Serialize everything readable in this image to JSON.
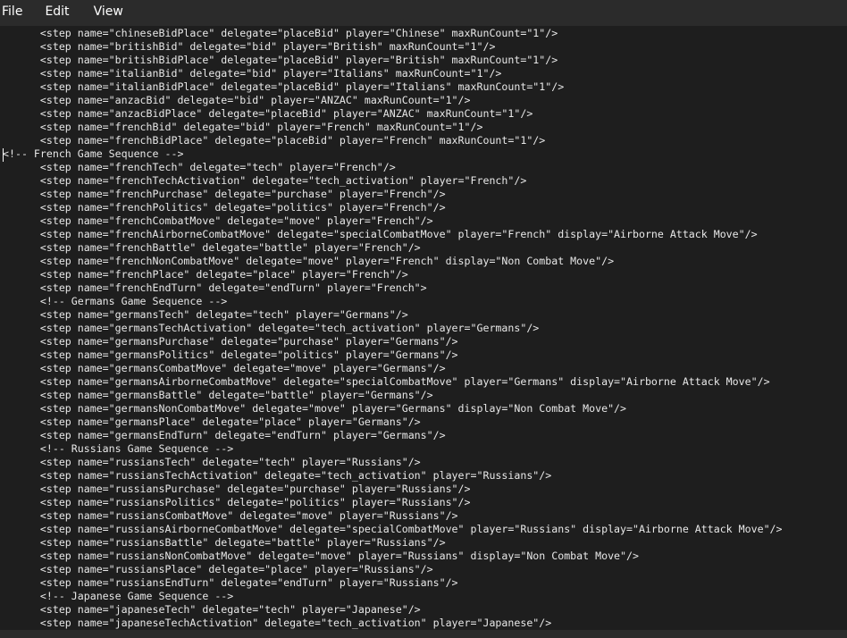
{
  "menu": {
    "file": "File",
    "edit": "Edit",
    "view": "View"
  },
  "editor": {
    "lines": [
      "      <step name=\"chineseBidPlace\" delegate=\"placeBid\" player=\"Chinese\" maxRunCount=\"1\"/>",
      "      <step name=\"britishBid\" delegate=\"bid\" player=\"British\" maxRunCount=\"1\"/>",
      "      <step name=\"britishBidPlace\" delegate=\"placeBid\" player=\"British\" maxRunCount=\"1\"/>",
      "      <step name=\"italianBid\" delegate=\"bid\" player=\"Italians\" maxRunCount=\"1\"/>",
      "      <step name=\"italianBidPlace\" delegate=\"placeBid\" player=\"Italians\" maxRunCount=\"1\"/>",
      "      <step name=\"anzacBid\" delegate=\"bid\" player=\"ANZAC\" maxRunCount=\"1\"/>",
      "      <step name=\"anzacBidPlace\" delegate=\"placeBid\" player=\"ANZAC\" maxRunCount=\"1\"/>",
      "      <step name=\"frenchBid\" delegate=\"bid\" player=\"French\" maxRunCount=\"1\"/>",
      "      <step name=\"frenchBidPlace\" delegate=\"placeBid\" player=\"French\" maxRunCount=\"1\"/>",
      "<!-- French Game Sequence -->",
      "      <step name=\"frenchTech\" delegate=\"tech\" player=\"French\"/>",
      "      <step name=\"frenchTechActivation\" delegate=\"tech_activation\" player=\"French\"/>",
      "      <step name=\"frenchPurchase\" delegate=\"purchase\" player=\"French\"/>",
      "      <step name=\"frenchPolitics\" delegate=\"politics\" player=\"French\"/>",
      "      <step name=\"frenchCombatMove\" delegate=\"move\" player=\"French\"/>",
      "      <step name=\"frenchAirborneCombatMove\" delegate=\"specialCombatMove\" player=\"French\" display=\"Airborne Attack Move\"/>",
      "      <step name=\"frenchBattle\" delegate=\"battle\" player=\"French\"/>",
      "      <step name=\"frenchNonCombatMove\" delegate=\"move\" player=\"French\" display=\"Non Combat Move\"/>",
      "      <step name=\"frenchPlace\" delegate=\"place\" player=\"French\"/>",
      "      <step name=\"frenchEndTurn\" delegate=\"endTurn\" player=\"French\">",
      "      <!-- Germans Game Sequence -->",
      "      <step name=\"germansTech\" delegate=\"tech\" player=\"Germans\"/>",
      "      <step name=\"germansTechActivation\" delegate=\"tech_activation\" player=\"Germans\"/>",
      "      <step name=\"germansPurchase\" delegate=\"purchase\" player=\"Germans\"/>",
      "      <step name=\"germansPolitics\" delegate=\"politics\" player=\"Germans\"/>",
      "      <step name=\"germansCombatMove\" delegate=\"move\" player=\"Germans\"/>",
      "      <step name=\"germansAirborneCombatMove\" delegate=\"specialCombatMove\" player=\"Germans\" display=\"Airborne Attack Move\"/>",
      "      <step name=\"germansBattle\" delegate=\"battle\" player=\"Germans\"/>",
      "      <step name=\"germansNonCombatMove\" delegate=\"move\" player=\"Germans\" display=\"Non Combat Move\"/>",
      "      <step name=\"germansPlace\" delegate=\"place\" player=\"Germans\"/>",
      "      <step name=\"germansEndTurn\" delegate=\"endTurn\" player=\"Germans\"/>",
      "      <!-- Russians Game Sequence -->",
      "      <step name=\"russiansTech\" delegate=\"tech\" player=\"Russians\"/>",
      "      <step name=\"russiansTechActivation\" delegate=\"tech_activation\" player=\"Russians\"/>",
      "      <step name=\"russiansPurchase\" delegate=\"purchase\" player=\"Russians\"/>",
      "      <step name=\"russiansPolitics\" delegate=\"politics\" player=\"Russians\"/>",
      "      <step name=\"russiansCombatMove\" delegate=\"move\" player=\"Russians\"/>",
      "      <step name=\"russiansAirborneCombatMove\" delegate=\"specialCombatMove\" player=\"Russians\" display=\"Airborne Attack Move\"/>",
      "      <step name=\"russiansBattle\" delegate=\"battle\" player=\"Russians\"/>",
      "      <step name=\"russiansNonCombatMove\" delegate=\"move\" player=\"Russians\" display=\"Non Combat Move\"/>",
      "      <step name=\"russiansPlace\" delegate=\"place\" player=\"Russians\"/>",
      "      <step name=\"russiansEndTurn\" delegate=\"endTurn\" player=\"Russians\"/>",
      "      <!-- Japanese Game Sequence -->",
      "      <step name=\"japaneseTech\" delegate=\"tech\" player=\"Japanese\"/>",
      "      <step name=\"japaneseTechActivation\" delegate=\"tech_activation\" player=\"Japanese\"/>"
    ]
  }
}
